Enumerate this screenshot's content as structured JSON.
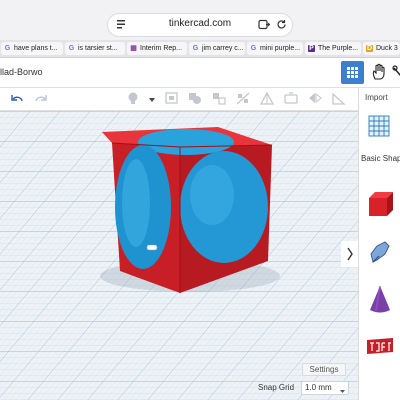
{
  "browser": {
    "url": "tinkercad.com",
    "tabs": [
      {
        "label": "have plans t...",
        "icon": "G"
      },
      {
        "label": "is tarsier st...",
        "icon": "G"
      },
      {
        "label": "Interim Rep...",
        "icon": "▦"
      },
      {
        "label": "jim carrey c...",
        "icon": "G"
      },
      {
        "label": "mini purple...",
        "icon": "G"
      },
      {
        "label": "The Purple...",
        "icon": "P"
      },
      {
        "label": "Duck 3",
        "icon": "D"
      }
    ]
  },
  "app": {
    "design_title": "llad-Borwo",
    "import_label": "Import",
    "shapes_category": "Basic Shap",
    "settings_label": "Settings",
    "snap_grid_label": "Snap Grid",
    "snap_grid_value": "1.0 mm",
    "collapse_arrow": "›"
  },
  "colors": {
    "accent": "#3c7fd0",
    "box_red": "#d8222a",
    "sphere_blue": "#2a9fd8",
    "cone_purple": "#7a3fa8"
  }
}
